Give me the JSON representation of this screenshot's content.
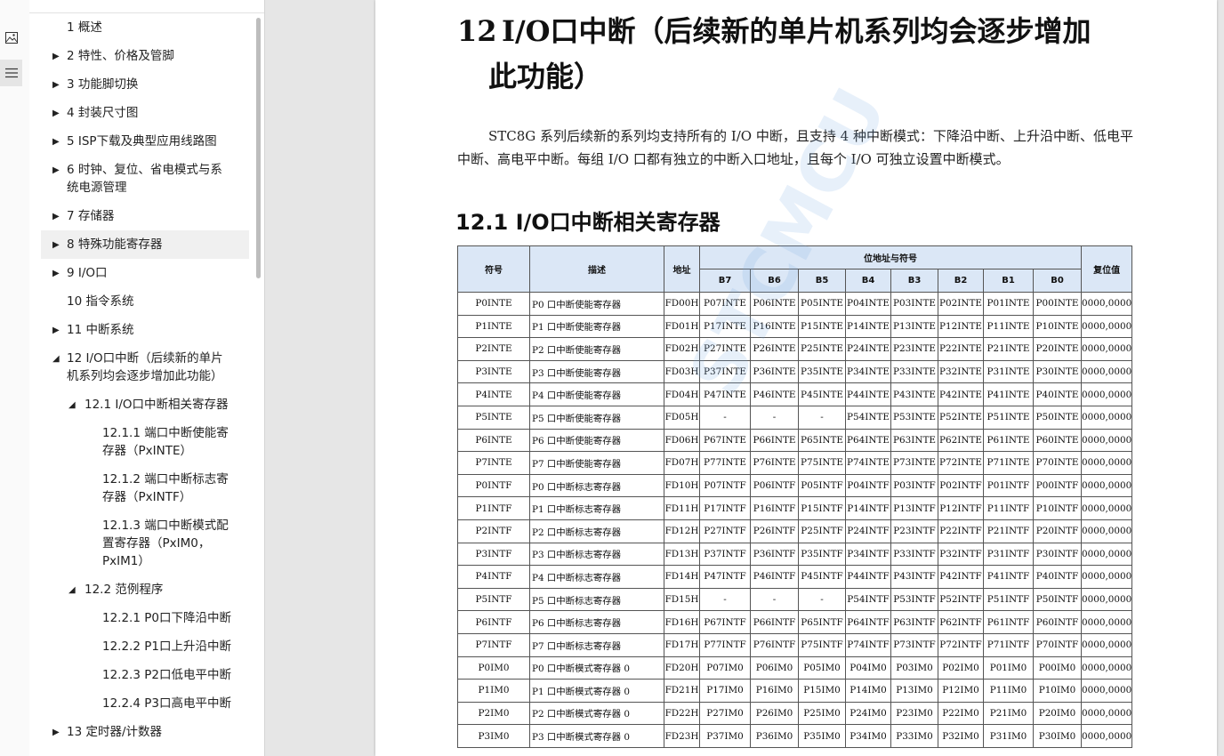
{
  "sidebar_icons": [
    {
      "icon": "image-icon",
      "glyph": "⊡"
    },
    {
      "icon": "list-icon",
      "glyph": "☰"
    }
  ],
  "outline": [
    {
      "label": "1 概述",
      "expandable": false,
      "level": 0
    },
    {
      "label": "2 特性、价格及管脚",
      "expandable": true,
      "level": 0
    },
    {
      "label": "3 功能脚切换",
      "expandable": true,
      "level": 0
    },
    {
      "label": "4 封装尺寸图",
      "expandable": true,
      "level": 0
    },
    {
      "label": "5 ISP下载及典型应用线路图",
      "expandable": true,
      "level": 0
    },
    {
      "label": "6 时钟、复位、省电模式与系",
      "label2": "统电源管理",
      "expandable": true,
      "level": 0
    },
    {
      "label": "7 存储器",
      "expandable": true,
      "level": 0
    },
    {
      "label": "8 特殊功能寄存器",
      "expandable": true,
      "level": 0,
      "hover": true
    },
    {
      "label": "9 I/O口",
      "expandable": true,
      "level": 0
    },
    {
      "label": "10 指令系统",
      "expandable": false,
      "level": 0
    },
    {
      "label": "11 中断系统",
      "expandable": true,
      "level": 0
    },
    {
      "label": "12 I/O口中断（后续新的单片",
      "label2": "机系列均会逐步增加此功能）",
      "expandable": true,
      "expanded": true,
      "level": 0
    },
    {
      "label": "12.1 I/O口中断相关寄存器",
      "expandable": true,
      "expanded": true,
      "level": 1
    },
    {
      "label": "12.1.1 端口中断使能寄",
      "label2": "存器（PxINTE）",
      "expandable": false,
      "level": 2
    },
    {
      "label": "12.1.2 端口中断标志寄",
      "label2": "存器（PxINTF）",
      "expandable": false,
      "level": 2
    },
    {
      "label": "12.1.3 端口中断模式配",
      "label2": "置寄存器（PxIM0，",
      "label3": "PxIM1）",
      "expandable": false,
      "level": 2
    },
    {
      "label": "12.2 范例程序",
      "expandable": true,
      "expanded": true,
      "level": 1
    },
    {
      "label": "12.2.1 P0口下降沿中断",
      "expandable": false,
      "level": 2
    },
    {
      "label": "12.2.2 P1口上升沿中断",
      "expandable": false,
      "level": 2
    },
    {
      "label": "12.2.3 P2口低电平中断",
      "expandable": false,
      "level": 2
    },
    {
      "label": "12.2.4 P3口高电平中断",
      "expandable": false,
      "level": 2
    },
    {
      "label": "13 定时器/计数器",
      "expandable": true,
      "level": 0
    }
  ],
  "document": {
    "chapter_number": "12",
    "chapter_title_line1": "I/O口中断（后续新的单片机系列均会逐步增加",
    "chapter_title_line2": "此功能）",
    "intro": "STC8G 系列后续新的系列均支持所有的 I/O 中断，且支持 4 种中断模式：下降沿中断、上升沿中断、低电平中断、高电平中断。每组 I/O 口都有独立的中断入口地址，且每个 I/O 可独立设置中断模式。",
    "section_title": "12.1   I/O口中断相关寄存器",
    "watermark": "STCMCU"
  },
  "table": {
    "headers": {
      "symbol": "符号",
      "desc": "描述",
      "addr": "地址",
      "bits_group": "位地址与符号",
      "reset": "复位值",
      "bits": [
        "B7",
        "B6",
        "B5",
        "B4",
        "B3",
        "B2",
        "B1",
        "B0"
      ]
    },
    "rows": [
      [
        "P0INTE",
        "P0 口中断使能寄存器",
        "FD00H",
        "P07INTE",
        "P06INTE",
        "P05INTE",
        "P04INTE",
        "P03INTE",
        "P02INTE",
        "P01INTE",
        "P00INTE",
        "0000,0000"
      ],
      [
        "P1INTE",
        "P1 口中断使能寄存器",
        "FD01H",
        "P17INTE",
        "P16INTE",
        "P15INTE",
        "P14INTE",
        "P13INTE",
        "P12INTE",
        "P11INTE",
        "P10INTE",
        "0000,0000"
      ],
      [
        "P2INTE",
        "P2 口中断使能寄存器",
        "FD02H",
        "P27INTE",
        "P26INTE",
        "P25INTE",
        "P24INTE",
        "P23INTE",
        "P22INTE",
        "P21INTE",
        "P20INTE",
        "0000,0000"
      ],
      [
        "P3INTE",
        "P3 口中断使能寄存器",
        "FD03H",
        "P37INTE",
        "P36INTE",
        "P35INTE",
        "P34INTE",
        "P33INTE",
        "P32INTE",
        "P31INTE",
        "P30INTE",
        "0000,0000"
      ],
      [
        "P4INTE",
        "P4 口中断使能寄存器",
        "FD04H",
        "P47INTE",
        "P46INTE",
        "P45INTE",
        "P44INTE",
        "P43INTE",
        "P42INTE",
        "P41INTE",
        "P40INTE",
        "0000,0000"
      ],
      [
        "P5INTE",
        "P5 口中断使能寄存器",
        "FD05H",
        "-",
        "-",
        "-",
        "P54INTE",
        "P53INTE",
        "P52INTE",
        "P51INTE",
        "P50INTE",
        "0000,0000"
      ],
      [
        "P6INTE",
        "P6 口中断使能寄存器",
        "FD06H",
        "P67INTE",
        "P66INTE",
        "P65INTE",
        "P64INTE",
        "P63INTE",
        "P62INTE",
        "P61INTE",
        "P60INTE",
        "0000,0000"
      ],
      [
        "P7INTE",
        "P7 口中断使能寄存器",
        "FD07H",
        "P77INTE",
        "P76INTE",
        "P75INTE",
        "P74INTE",
        "P73INTE",
        "P72INTE",
        "P71INTE",
        "P70INTE",
        "0000,0000"
      ],
      [
        "P0INTF",
        "P0 口中断标志寄存器",
        "FD10H",
        "P07INTF",
        "P06INTF",
        "P05INTF",
        "P04INTF",
        "P03INTF",
        "P02INTF",
        "P01INTF",
        "P00INTF",
        "0000,0000"
      ],
      [
        "P1INTF",
        "P1 口中断标志寄存器",
        "FD11H",
        "P17INTF",
        "P16INTF",
        "P15INTF",
        "P14INTF",
        "P13INTF",
        "P12INTF",
        "P11INTF",
        "P10INTF",
        "0000,0000"
      ],
      [
        "P2INTF",
        "P2 口中断标志寄存器",
        "FD12H",
        "P27INTF",
        "P26INTF",
        "P25INTF",
        "P24INTF",
        "P23INTF",
        "P22INTF",
        "P21INTF",
        "P20INTF",
        "0000,0000"
      ],
      [
        "P3INTF",
        "P3 口中断标志寄存器",
        "FD13H",
        "P37INTF",
        "P36INTF",
        "P35INTF",
        "P34INTF",
        "P33INTF",
        "P32INTF",
        "P31INTF",
        "P30INTF",
        "0000,0000"
      ],
      [
        "P4INTF",
        "P4 口中断标志寄存器",
        "FD14H",
        "P47INTF",
        "P46INTF",
        "P45INTF",
        "P44INTF",
        "P43INTF",
        "P42INTF",
        "P41INTF",
        "P40INTF",
        "0000,0000"
      ],
      [
        "P5INTF",
        "P5 口中断标志寄存器",
        "FD15H",
        "-",
        "-",
        "-",
        "P54INTF",
        "P53INTF",
        "P52INTF",
        "P51INTF",
        "P50INTF",
        "0000,0000"
      ],
      [
        "P6INTF",
        "P6 口中断标志寄存器",
        "FD16H",
        "P67INTF",
        "P66INTF",
        "P65INTF",
        "P64INTF",
        "P63INTF",
        "P62INTF",
        "P61INTF",
        "P60INTF",
        "0000,0000"
      ],
      [
        "P7INTF",
        "P7 口中断标志寄存器",
        "FD17H",
        "P77INTF",
        "P76INTF",
        "P75INTF",
        "P74INTF",
        "P73INTF",
        "P72INTF",
        "P71INTF",
        "P70INTF",
        "0000,0000"
      ],
      [
        "P0IM0",
        "P0 口中断模式寄存器 0",
        "FD20H",
        "P07IM0",
        "P06IM0",
        "P05IM0",
        "P04IM0",
        "P03IM0",
        "P02IM0",
        "P01IM0",
        "P00IM0",
        "0000,0000"
      ],
      [
        "P1IM0",
        "P1 口中断模式寄存器 0",
        "FD21H",
        "P17IM0",
        "P16IM0",
        "P15IM0",
        "P14IM0",
        "P13IM0",
        "P12IM0",
        "P11IM0",
        "P10IM0",
        "0000,0000"
      ],
      [
        "P2IM0",
        "P2 口中断模式寄存器 0",
        "FD22H",
        "P27IM0",
        "P26IM0",
        "P25IM0",
        "P24IM0",
        "P23IM0",
        "P22IM0",
        "P21IM0",
        "P20IM0",
        "0000,0000"
      ],
      [
        "P3IM0",
        "P3 口中断模式寄存器 0",
        "FD23H",
        "P37IM0",
        "P36IM0",
        "P35IM0",
        "P34IM0",
        "P33IM0",
        "P32IM0",
        "P31IM0",
        "P30IM0",
        "0000,0000"
      ]
    ]
  }
}
